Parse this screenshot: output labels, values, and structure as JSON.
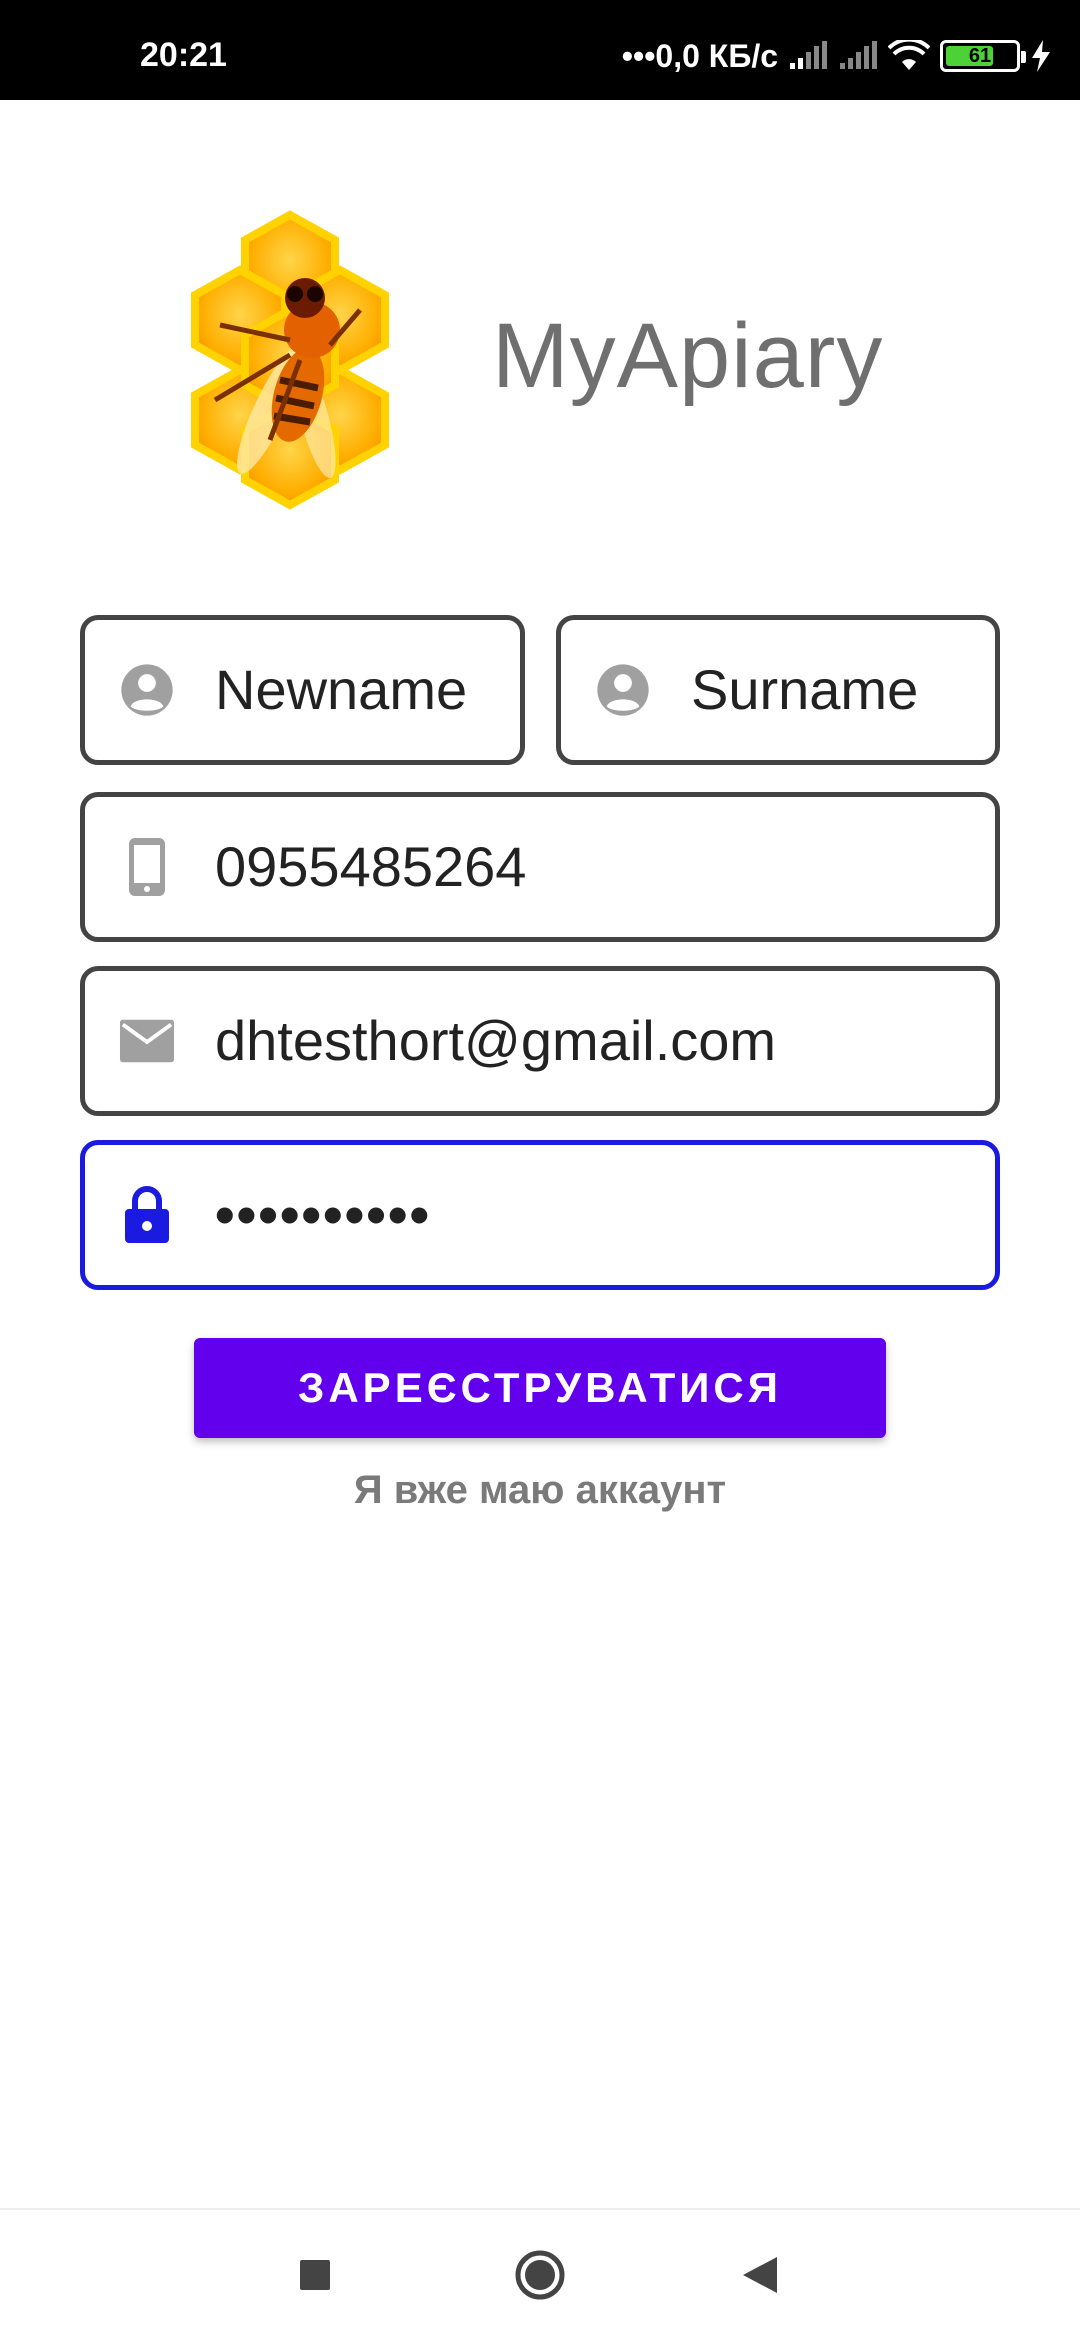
{
  "status_bar": {
    "time": "20:21",
    "network_speed": "•••0,0 КБ/с",
    "battery_level": "61"
  },
  "header": {
    "app_title": "MyApiary"
  },
  "form": {
    "first_name": "Newname",
    "surname": "Surname",
    "phone": "0955485264",
    "email": "dhtesthort@gmail.com",
    "password_masked": "••••••••••"
  },
  "actions": {
    "register_label": "ЗАРЕЄСТРУВАТИСЯ",
    "login_link": "Я вже маю аккаунт"
  },
  "colors": {
    "primary": "#6200ee",
    "focused_border": "#1a1ae0",
    "field_border": "#444444",
    "icon_gray": "#a0a0a0"
  },
  "icons": {
    "first_name": "person-icon",
    "surname": "person-icon",
    "phone": "phone-icon",
    "email": "mail-icon",
    "password": "lock-icon"
  }
}
